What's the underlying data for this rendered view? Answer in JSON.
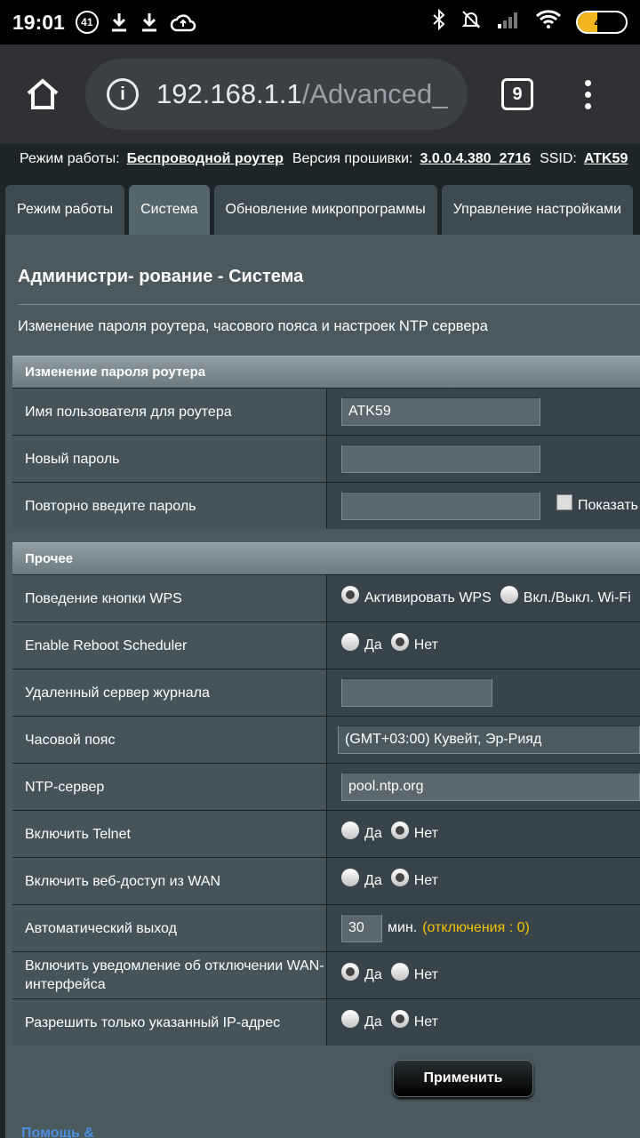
{
  "statusbar": {
    "time": "19:01",
    "notif_count": "41",
    "battery": "41",
    "battery_fraction": 0.41
  },
  "browser": {
    "url_host": "192.168.1.1",
    "url_path": "/Advanced_",
    "tab_count": "9"
  },
  "infobar": {
    "mode_label": "Режим работы:",
    "mode_value": "Беспроводной роутер",
    "fw_label": "Версия прошивки:",
    "fw_value": "3.0.0.4.380_2716",
    "ssid_label": "SSID:",
    "ssid_value": "ATK59"
  },
  "tabs": [
    "Режим работы",
    "Система",
    "Обновление микропрограммы",
    "Управление настройками"
  ],
  "page": {
    "title": "Администри- рование - Система",
    "description": "Изменение пароля роутера, часового пояса и настроек NTP сервера"
  },
  "password_section": {
    "header": "Изменение пароля роутера",
    "username_label": "Имя пользователя для роутера",
    "username_value": "ATK59",
    "new_password_label": "Новый пароль",
    "repeat_password_label": "Повторно введите пароль",
    "show_label": "Показать"
  },
  "misc_section": {
    "header": "Прочее",
    "wps_label": "Поведение кнопки WPS",
    "wps_opt1": "Активировать WPS",
    "wps_opt2": "Вкл./Выкл. Wi-Fi",
    "reboot_label": "Enable Reboot Scheduler",
    "yes": "Да",
    "no": "Нет",
    "syslog_label": "Удаленный сервер журнала",
    "tz_label": "Часовой пояс",
    "tz_value": "(GMT+03:00) Кувейт, Эр-Рияд",
    "ntp_label": "NTP-сервер",
    "ntp_value": "pool.ntp.org",
    "telnet_label": "Включить Telnet",
    "wan_access_label": "Включить веб-доступ из WAN",
    "logout_label": "Автоматический выход",
    "logout_value": "30",
    "logout_unit": "мин.",
    "logout_hint": "(отключения : 0)",
    "wan_notify_label": "Включить уведомление об отключении WAN-интерфейса",
    "ip_only_label": "Разрешить только указанный IP-адрес"
  },
  "apply_label": "Применить",
  "help_label": "Помощь &"
}
